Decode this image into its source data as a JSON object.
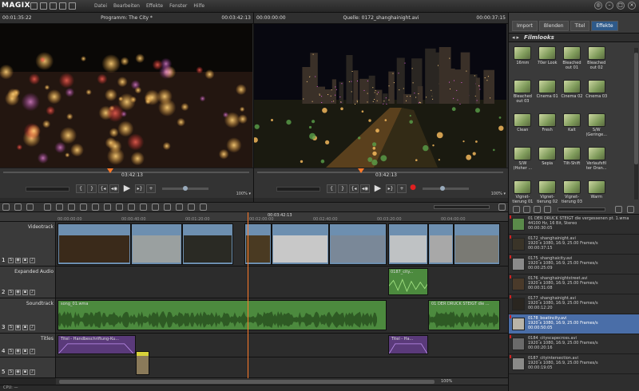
{
  "app": {
    "logo": "MAGIX"
  },
  "menu": [
    "Datei",
    "Bearbeiten",
    "Effekte",
    "Fenster",
    "Hilfe"
  ],
  "program_monitor": {
    "timecode_left": "00:01:35:22",
    "title": "Programm: The City *",
    "timecode_right": "00:03:42:13",
    "position": "03:42:13",
    "zoom": "100% ▾"
  },
  "source_monitor": {
    "timecode_left": "00:00:00:00",
    "title": "Quelle: 0172_shanghainight.avi",
    "timecode_right": "00:00:37:15",
    "position": "03:42:13",
    "zoom": "100% ▾"
  },
  "transport": {
    "prev": "{",
    "next": "}",
    "mark_in": "{◂",
    "loop": "◂◉",
    "play": "▶",
    "mark_out": "▸}",
    "skip": "+",
    "record": "●"
  },
  "tabs": [
    "Import",
    "Blenden",
    "Titel",
    "Effekte"
  ],
  "active_tab": "Effekte",
  "effects": {
    "category": "Filmlooks",
    "items": [
      "16mm",
      "70er Look",
      "Bleached out 01",
      "Bleached out 02",
      "Bleached out 03",
      "Cinema 01",
      "Cinema 02",
      "Cinema 03",
      "Clean",
      "Fresh",
      "Kalt",
      "S/W (Geringe...",
      "S/W (Hoher ...",
      "Sepia",
      "Tilt-Shift",
      "Verlaufsfil ter Oran...",
      "Vignet- tierung 01",
      "Vignet- tierung 02",
      "Vignet- tierung 03",
      "Warm"
    ]
  },
  "timeline": {
    "position": "00:03:42:13",
    "ruler_marks": [
      "00:00:00:00",
      "00:00:40:00",
      "00:01:20:00",
      "00:02:00:00",
      "00:02:40:00",
      "00:03:20:00",
      "00:04:00:00"
    ],
    "zoom": "100%",
    "tracks": [
      {
        "num": "1",
        "name": "Videotrack"
      },
      {
        "num": "2",
        "name": "Expanded Audio"
      },
      {
        "num": "3",
        "name": "Soundtrack"
      },
      {
        "num": "4",
        "name": "Titles"
      },
      {
        "num": "5",
        "name": ""
      }
    ],
    "clips": {
      "audio_expanded": "0187_city...",
      "soundtrack_a": "song_01.wma",
      "soundtrack_b": "01 DER DRUCK STEIGT die ...",
      "title_a": "Titel - Handbeschriftung-Ku...",
      "title_b": "Titel - Ha..."
    }
  },
  "media": [
    {
      "name": "01 DER DRUCK STEIGT die vergessenen pt. 1.wma",
      "info": "44100 Hz, 16 Bit, Stereo",
      "duration": "00:00:30:05",
      "thumb": "#5a8a4a"
    },
    {
      "name": "0172_shanghainight.avi",
      "info": "1920 x 1080, 16:9, 25.00 Frames/s",
      "duration": "00:00:37:15",
      "thumb": "#3a3428"
    },
    {
      "name": "0175_shanghaicity.avi",
      "info": "1920 x 1080, 16:9, 25.00 Frames/s",
      "duration": "00:00:25:09",
      "thumb": "#8a8a8a"
    },
    {
      "name": "0176_shanghainightstreet.avi",
      "info": "1920 x 1080, 16:9, 25.00 Frames/s",
      "duration": "00:00:31:08",
      "thumb": "#4a3a2a"
    },
    {
      "name": "0177_shanghainight.avi",
      "info": "1920 x 1080, 16:9, 25.00 Frames/s",
      "duration": "00:00:12:20",
      "thumb": "#2a2620"
    },
    {
      "name": "0178_boatincity.avi",
      "info": "1920 x 1080, 16:9, 25.00 Frames/s",
      "duration": "00:00:50:05",
      "thumb": "#b9b4a8"
    },
    {
      "name": "0184_cityscapecross.avi",
      "info": "1920 x 1080, 16:9, 25.00 Frames/s",
      "duration": "00:00:20:16",
      "thumb": "#6a6a6a"
    },
    {
      "name": "0187_cityintersection.avi",
      "info": "1920 x 1080, 16:9, 25.00 Frames/s",
      "duration": "00:00:19:05",
      "thumb": "#8a8a88"
    }
  ],
  "selected_media": 5,
  "status": "CPU: —",
  "colors": {
    "accent": "#2e5a8a",
    "playhead": "#ff7a2a",
    "audio": "#4c8a3e",
    "video": "#6d8fb0",
    "title": "#5a3a7a"
  }
}
